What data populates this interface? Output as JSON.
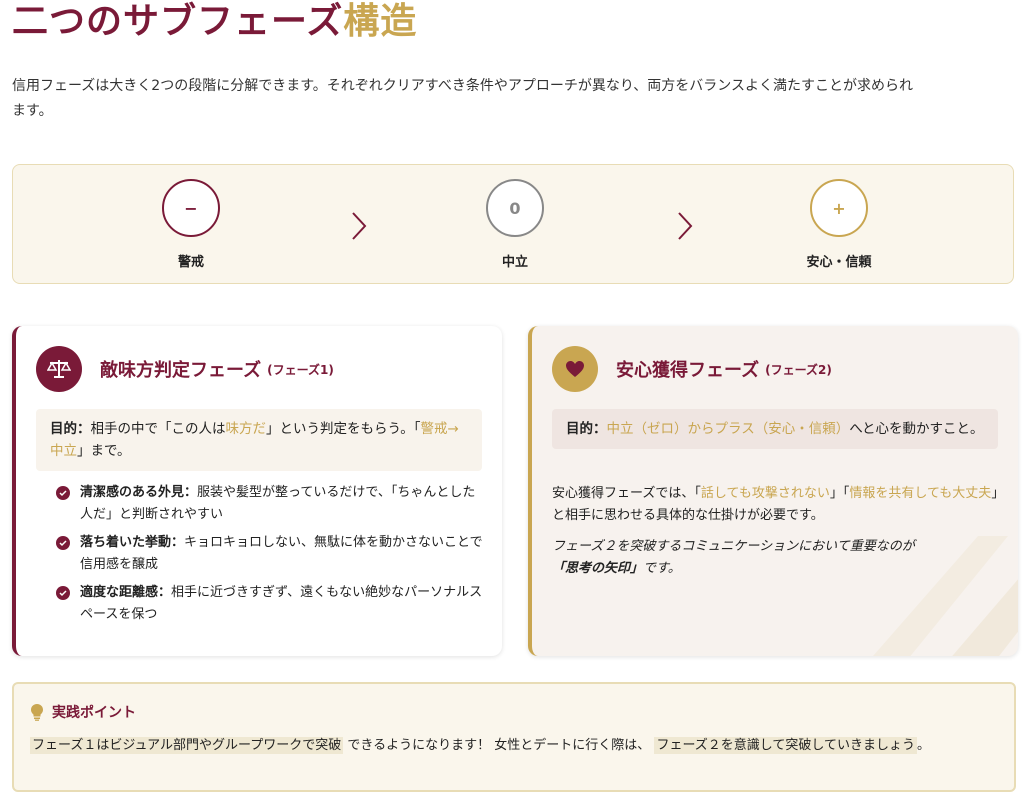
{
  "page": {
    "title_main": "二つのサブフェーズ",
    "title_accent": "構造",
    "intro": "信用フェーズは大きく2つの段階に分解できます。それぞれクリアすべき条件やアプローチが異なり、両方をバランスよく満たすことが求められます。"
  },
  "stepper": {
    "steps": [
      {
        "symbol": "−",
        "label": "警戒",
        "color": "#7a1a38"
      },
      {
        "symbol": "0",
        "label": "中立",
        "color": "#888888"
      },
      {
        "symbol": "+",
        "label": "安心・信頼",
        "color": "#c9a651"
      }
    ]
  },
  "phase1": {
    "icon": "scale-icon",
    "title": "敵味方判定フェーズ",
    "subtitle": "(フェーズ1)",
    "goal_label": "目的：",
    "goal_parts": [
      "相手の中で「この人は",
      "味方だ",
      "」という判定をもらう。「",
      "警戒→中立",
      "」まで。"
    ],
    "items": [
      {
        "head": "清潔感のある外見：",
        "text": "服装や髪型が整っているだけで、「ちゃんとした人だ」と判断されやすい"
      },
      {
        "head": "落ち着いた挙動：",
        "text": "キョロキョロしない、無駄に体を動かさないことで信用感を醸成"
      },
      {
        "head": "適度な距離感：",
        "text": "相手に近づきすぎず、遠くもない絶妙なパーソナルスペースを保つ"
      }
    ]
  },
  "phase2": {
    "icon": "heart-icon",
    "title": "安心獲得フェーズ",
    "subtitle": "(フェーズ2)",
    "goal_label": "目的：",
    "goal_highlight": "中立（ゼロ）からプラス（安心・信頼）",
    "goal_rest": "へと心を動かすこと。",
    "desc_parts": [
      "安心獲得フェーズでは、「",
      "話しても攻撃されない",
      "」「",
      "情報を共有しても大丈夫",
      "」と相手に思わせる具体的な仕掛けが必要です。"
    ],
    "note_text": "フェーズ２を突破するコミュニケーションにおいて重要なのが",
    "note_bold": "「思考の矢印」",
    "note_end": "です。"
  },
  "practice": {
    "icon": "lightbulb-icon",
    "title": "実践ポイント",
    "mark1": "フェーズ１はビジュアル部門やグループワークで突破",
    "text1": "できるようになります！ 女性とデートに行く際は、",
    "mark2": "フェーズ２を意識して突破していきましょう",
    "text2": "。"
  },
  "colors": {
    "primary": "#7a1a38",
    "accent": "#c9a651"
  }
}
